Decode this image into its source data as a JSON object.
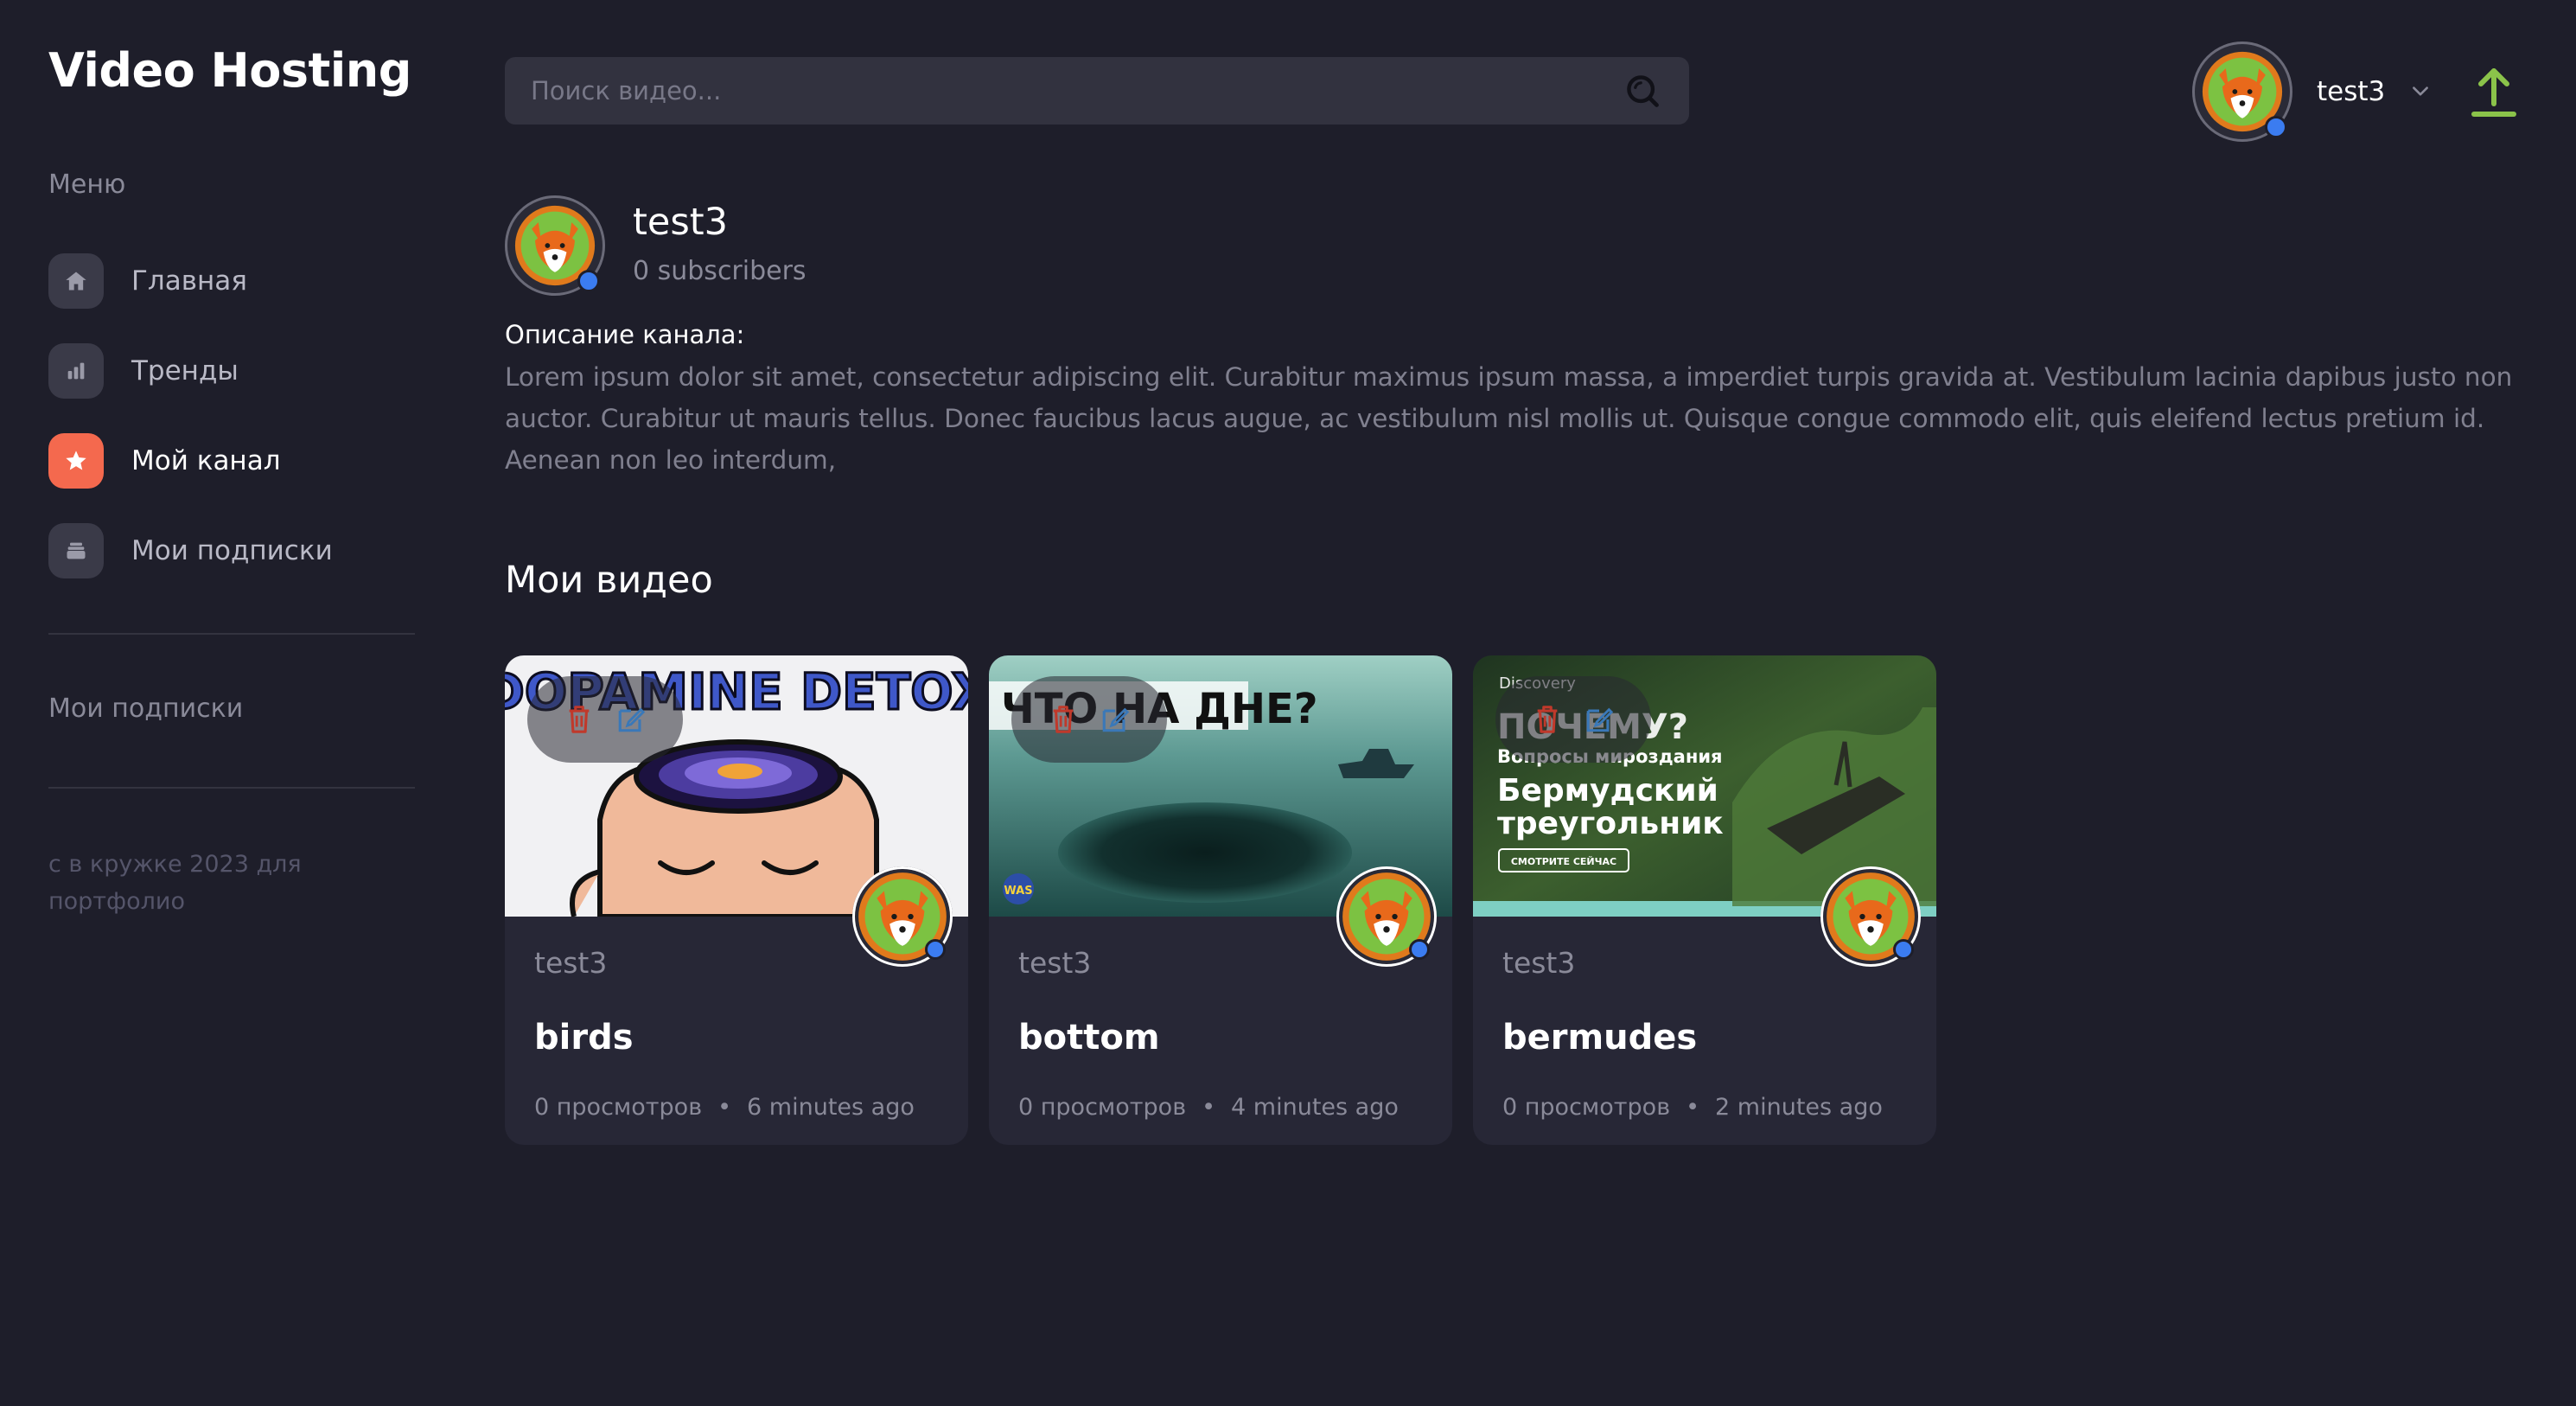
{
  "app": {
    "logo": "Video Hosting"
  },
  "sidebar": {
    "menu_caption": "Меню",
    "items": [
      {
        "label": "Главная",
        "icon": "home-icon",
        "active": false
      },
      {
        "label": "Тренды",
        "icon": "chart-icon",
        "active": false
      },
      {
        "label": "Мой канал",
        "icon": "star-icon",
        "active": true
      },
      {
        "label": "Мои подписки",
        "icon": "inbox-icon",
        "active": false
      }
    ],
    "subscriptions_caption": "Мои подписки",
    "footer_note": "с в кружке 2023 для портфолио"
  },
  "header": {
    "search_placeholder": "Поиск видео...",
    "user_name": "test3"
  },
  "channel": {
    "name": "test3",
    "subscribers": "0 subscribers",
    "description_title": "Описание канала:",
    "description": "Lorem ipsum dolor sit amet, consectetur adipiscing elit. Curabitur maximus ipsum massa, a imperdiet turpis gravida at. Vestibulum lacinia dapibus justo non auctor. Curabitur ut mauris tellus. Donec faucibus lacus augue, ac vestibulum nisl mollis ut. Quisque congue commodo elit, quis eleifend lectus pretium id. Aenean non leo interdum,"
  },
  "videos_section": {
    "title": "Мои видео",
    "videos": [
      {
        "author": "test3",
        "title": "birds",
        "views": "0 просмотров",
        "age": "6 minutes ago",
        "thumb_text": "DOPAMINE DETOX"
      },
      {
        "author": "test3",
        "title": "bottom",
        "views": "0 просмотров",
        "age": "4 minutes ago",
        "thumb_text": "ЧТО НА ДНЕ?",
        "thumb_badge": "WAS"
      },
      {
        "author": "test3",
        "title": "bermudes",
        "views": "0 просмотров",
        "age": "2 minutes ago",
        "thumb_brand": "Discovery",
        "thumb_heading": "ПОЧЕМУ?",
        "thumb_sub": "Вопросы мироздания",
        "thumb_line1": "Бермудский",
        "thumb_line2": "треугольник",
        "thumb_button": "СМОТРИТЕ СЕЙЧАС"
      }
    ]
  },
  "colors": {
    "background": "#1e1e2a",
    "accent": "#f4694e",
    "upload": "#8bc34a",
    "card": "#272736"
  }
}
